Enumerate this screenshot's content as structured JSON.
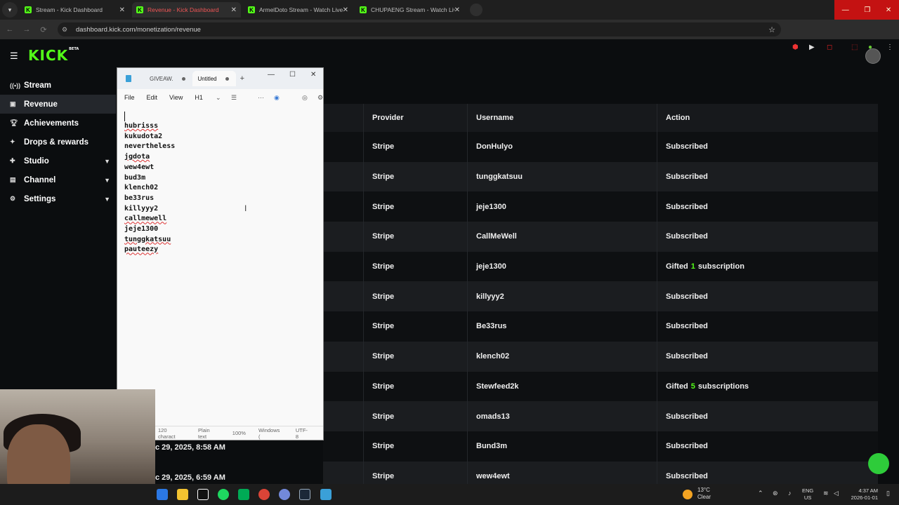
{
  "browser": {
    "tabs": [
      {
        "title": "Stream - Kick Dashboard",
        "active": false
      },
      {
        "title": "Revenue - Kick Dashboard",
        "active": true
      },
      {
        "title": "ArmelDoto Stream - Watch Live",
        "active": false
      },
      {
        "title": "CHUPAENG Stream - Watch Live",
        "active": false
      }
    ],
    "url": "dashboard.kick.com/monetization/revenue",
    "accent_color": "#53fc18"
  },
  "kick": {
    "logo": "KICK",
    "logo_badge": "BETA",
    "sidebar": [
      {
        "label": "Stream",
        "icon": "broadcast-icon",
        "active": false,
        "expandable": false
      },
      {
        "label": "Revenue",
        "icon": "revenue-icon",
        "active": true,
        "expandable": false
      },
      {
        "label": "Achievements",
        "icon": "trophy-icon",
        "active": false,
        "expandable": false
      },
      {
        "label": "Drops & rewards",
        "icon": "gift-icon",
        "active": false,
        "expandable": false
      },
      {
        "label": "Studio",
        "icon": "studio-icon",
        "active": false,
        "expandable": true
      },
      {
        "label": "Channel",
        "icon": "channel-icon",
        "active": false,
        "expandable": true
      },
      {
        "label": "Settings",
        "icon": "gear-icon",
        "active": false,
        "expandable": true
      }
    ],
    "table": {
      "headers": [
        "Provider",
        "Username",
        "Action"
      ],
      "rows": [
        {
          "provider": "Stripe",
          "username": "DonHulyo",
          "action": "Subscribed"
        },
        {
          "provider": "Stripe",
          "username": "tunggkatsuu",
          "action": "Subscribed"
        },
        {
          "provider": "Stripe",
          "username": "jeje1300",
          "action": "Subscribed"
        },
        {
          "provider": "Stripe",
          "username": "CallMeWell",
          "action": "Subscribed"
        },
        {
          "provider": "Stripe",
          "username": "jeje1300",
          "action_pre": "Gifted",
          "action_num": "1",
          "action_post": "subscription"
        },
        {
          "provider": "Stripe",
          "username": "killyyy2",
          "action": "Subscribed"
        },
        {
          "provider": "Stripe",
          "username": "Be33rus",
          "action": "Subscribed"
        },
        {
          "provider": "Stripe",
          "username": "klench02",
          "action": "Subscribed"
        },
        {
          "provider": "Stripe",
          "username": "Stewfeed2k",
          "action_pre": "Gifted",
          "action_num": "5",
          "action_post": "subscriptions"
        },
        {
          "provider": "Stripe",
          "username": "omads13",
          "action": "Subscribed"
        },
        {
          "provider": "Stripe",
          "username": "Bund3m",
          "action": "Subscribed"
        },
        {
          "provider": "Stripe",
          "username": "wew4ewt",
          "action": "Subscribed"
        }
      ],
      "visible_dates": [
        "c 29, 2025, 8:58 AM",
        "c 29, 2025, 6:59 AM"
      ]
    }
  },
  "notepad": {
    "tabs": [
      "GIVEAW.",
      "Untitled"
    ],
    "menu": [
      "File",
      "Edit",
      "View",
      "H1"
    ],
    "lines": [
      "hubrisss",
      "kukudota2",
      "nevertheless",
      "jgdota",
      "wew4ewt",
      "bud3m",
      "klench02",
      "be33rus",
      "killyyy2",
      "callmewell",
      "jeje1300",
      "tunggkatsuu",
      "pauteezy"
    ],
    "misspelled": [
      "hubrisss",
      "jgdota",
      "callmewell",
      "tunggkatsuu",
      "pauteezy"
    ],
    "status": {
      "chars": "120 charact",
      "format": "Plain text",
      "zoom": "100%",
      "line_ending": "Windows (",
      "encoding": "UTF-8"
    }
  },
  "taskbar": {
    "weather_temp": "13°C",
    "weather_desc": "Clear",
    "lang_top": "ENG",
    "lang_bottom": "US",
    "time": "4:37 AM",
    "date": "2026-01-01"
  }
}
